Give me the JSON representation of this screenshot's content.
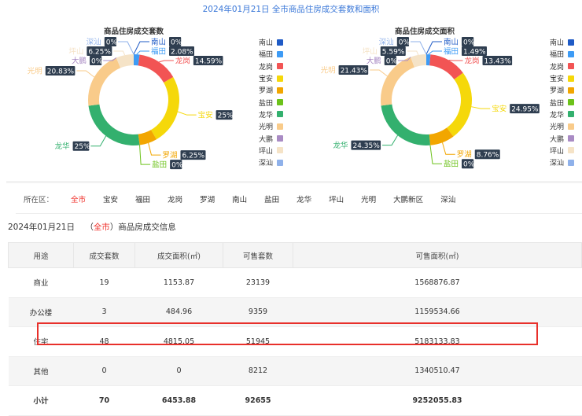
{
  "title": "2024年01月21日 全市商品住房成交套数和面积",
  "chart_data": [
    {
      "type": "pie",
      "title": "商品住房成交套数",
      "categories": [
        "南山",
        "福田",
        "龙岗",
        "宝安",
        "罗湖",
        "盐田",
        "龙华",
        "光明",
        "大鹏",
        "坪山",
        "深汕"
      ],
      "values": [
        0,
        2.08,
        14.59,
        25,
        6.25,
        0,
        25,
        20.83,
        0,
        6.25,
        0
      ],
      "labels": [
        "0%",
        "2.08%",
        "14.59%",
        "25%",
        "6.25%",
        "0%",
        "25%",
        "20.83%",
        "0%",
        "6.25%",
        "0%"
      ]
    },
    {
      "type": "pie",
      "title": "商品住房成交面积",
      "categories": [
        "南山",
        "福田",
        "龙岗",
        "宝安",
        "罗湖",
        "盐田",
        "龙华",
        "光明",
        "大鹏",
        "坪山",
        "深汕"
      ],
      "values": [
        0,
        1.49,
        13.43,
        24.95,
        8.76,
        0,
        24.35,
        21.43,
        0,
        5.59,
        0
      ],
      "labels": [
        "0%",
        "1.49%",
        "13.43%",
        "24.95%",
        "8.76%",
        "0%",
        "24.35%",
        "21.43%",
        "0%",
        "5.59%",
        "0%"
      ]
    }
  ],
  "colors": [
    "#1f5bc6",
    "#3d9bf5",
    "#f25454",
    "#f5d80a",
    "#f2a600",
    "#6cc21a",
    "#33b06e",
    "#f9cb8a",
    "#a98bc4",
    "#f5e3c7",
    "#8fb1ea"
  ],
  "filter": {
    "label": "所在区：",
    "items": [
      "全市",
      "宝安",
      "福田",
      "龙岗",
      "罗湖",
      "南山",
      "盐田",
      "龙华",
      "坪山",
      "光明",
      "大鹏新区",
      "深汕"
    ],
    "active": 0
  },
  "info": {
    "date": "2024年01月21日",
    "open": "（",
    "district": "全市",
    "close": "）商品房成交信息"
  },
  "table": {
    "headers": [
      "用途",
      "成交套数",
      "成交面积(㎡)",
      "可售套数",
      "可售面积(㎡)"
    ],
    "rows": [
      [
        "商业",
        "19",
        "1153.87",
        "23139",
        "1568876.87"
      ],
      [
        "办公楼",
        "3",
        "484.96",
        "9359",
        "1159534.66"
      ],
      [
        "住宅",
        "48",
        "4815.05",
        "51945",
        "5183133.83"
      ],
      [
        "其他",
        "0",
        "0",
        "8212",
        "1340510.47"
      ],
      [
        "小计",
        "70",
        "6453.88",
        "92655",
        "9252055.83"
      ]
    ]
  }
}
